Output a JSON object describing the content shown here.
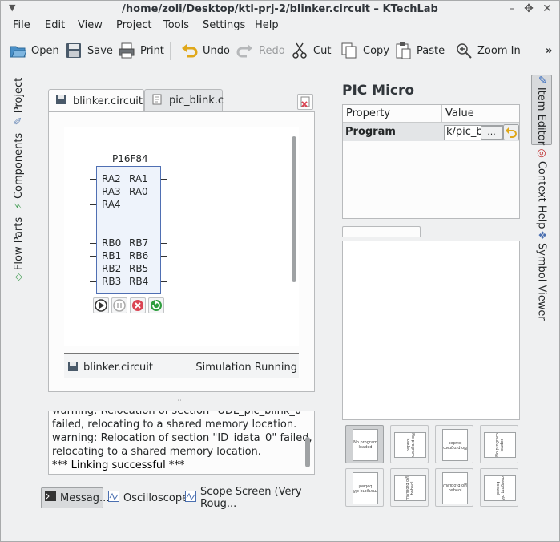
{
  "window": {
    "title": "/home/zoli/Desktop/ktl-prj-2/blinker.circuit – KTechLab"
  },
  "menubar": [
    "File",
    "Edit",
    "View",
    "Project",
    "Tools",
    "Settings",
    "Help"
  ],
  "toolbar": {
    "open": "Open",
    "save": "Save",
    "print": "Print",
    "undo": "Undo",
    "redo": "Redo",
    "cut": "Cut",
    "copy": "Copy",
    "paste": "Paste",
    "zoom_in": "Zoom In",
    "overflow": "»"
  },
  "left_dock": {
    "project": "Project",
    "components": "Components",
    "flow_parts": "Flow Parts"
  },
  "right_dock": {
    "item_editor": "Item Editor",
    "context_help": "Context Help",
    "symbol_viewer": "Symbol Viewer"
  },
  "tabs": [
    {
      "label": "blinker.circuit",
      "active": true
    },
    {
      "label": "pic_blink.c",
      "active": false
    }
  ],
  "circuit": {
    "chip_name": "P16F84",
    "left_pins": [
      "RA2",
      "RA3",
      "RA4",
      "RB0",
      "RB1",
      "RB2",
      "RB3"
    ],
    "right_pins": [
      "RA1",
      "RA0",
      "RB7",
      "RB6",
      "RB5",
      "RB4"
    ]
  },
  "status": {
    "file": "blinker.circuit",
    "sim": "Simulation Running"
  },
  "messages": {
    "lines": [
      "warning: Relocation of section \"UDL_pic_blink_0\"",
      "failed, relocating to a shared memory location.",
      "warning: Relocation of section \"ID_idata_0\" failed,",
      "relocating to a shared memory location.",
      "*** Linking successful ***"
    ]
  },
  "bottom_tabs": [
    "Messag...",
    "Oscilloscope",
    "Scope Screen (Very Roug..."
  ],
  "item_editor": {
    "title": "PIC Micro",
    "header_property": "Property",
    "header_value": "Value",
    "row_label": "Program",
    "row_value": "k/pic_bl",
    "dots": "..."
  },
  "orientations": [
    {
      "label": "No program loaded",
      "selected": true
    },
    {
      "label": "No program loaded",
      "selected": false
    },
    {
      "label": "No program loaded",
      "selected": false
    },
    {
      "label": "No program loaded",
      "selected": false
    },
    {
      "label": "No program loaded",
      "selected": false
    },
    {
      "label": "No program loaded",
      "selected": false
    },
    {
      "label": "No program loaded",
      "selected": false
    },
    {
      "label": "No program loaded",
      "selected": false
    }
  ],
  "colors": {
    "accent": "#3daee9",
    "chip_border": "#4f6fb3",
    "run_green": "#2e9e3e",
    "stop_red": "#da4453"
  }
}
